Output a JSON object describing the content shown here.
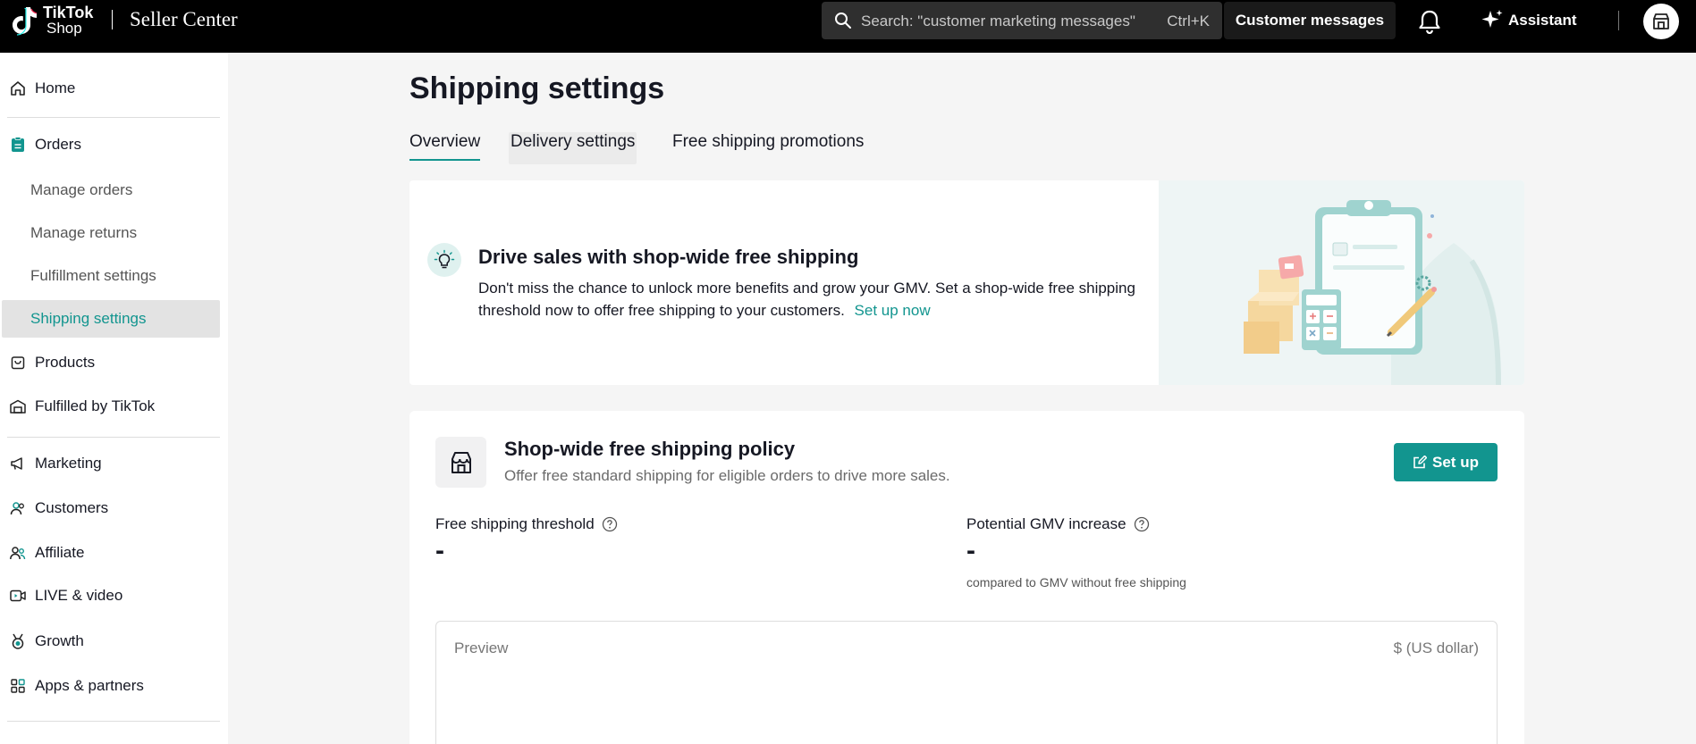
{
  "header": {
    "logo_line1": "TikTok",
    "logo_line2": "Shop",
    "product": "Seller Center",
    "search_placeholder": "Search: \"customer marketing messages\"",
    "search_shortcut": "Ctrl+K",
    "customer_messages": "Customer messages",
    "assistant": "Assistant"
  },
  "sidebar": {
    "home": "Home",
    "orders": "Orders",
    "orders_sub": [
      "Manage orders",
      "Manage returns",
      "Fulfillment settings",
      "Shipping settings"
    ],
    "products": "Products",
    "fulfilled": "Fulfilled by TikTok",
    "marketing": "Marketing",
    "customers": "Customers",
    "affiliate": "Affiliate",
    "live": "LIVE & video",
    "growth": "Growth",
    "apps": "Apps & partners"
  },
  "main": {
    "title": "Shipping settings",
    "tabs": [
      "Overview",
      "Delivery settings",
      "Free shipping promotions"
    ],
    "banner": {
      "heading": "Drive sales with shop-wide free shipping",
      "body": "Don't miss the chance to unlock more benefits and grow your GMV. Set a shop-wide free shipping threshold now to offer free shipping to your customers.",
      "link": "Set up now"
    },
    "policy": {
      "heading": "Shop-wide free shipping policy",
      "subtitle": "Offer free standard shipping for eligible orders to drive more sales.",
      "button": "Set up",
      "threshold_label": "Free shipping threshold",
      "threshold_value": "-",
      "gmv_label": "Potential GMV increase",
      "gmv_value": "-",
      "gmv_note": "compared to GMV without free shipping",
      "preview_label": "Preview",
      "currency": "$ (US dollar)"
    }
  },
  "colors": {
    "accent": "#12958f",
    "topbar": "#000000"
  }
}
